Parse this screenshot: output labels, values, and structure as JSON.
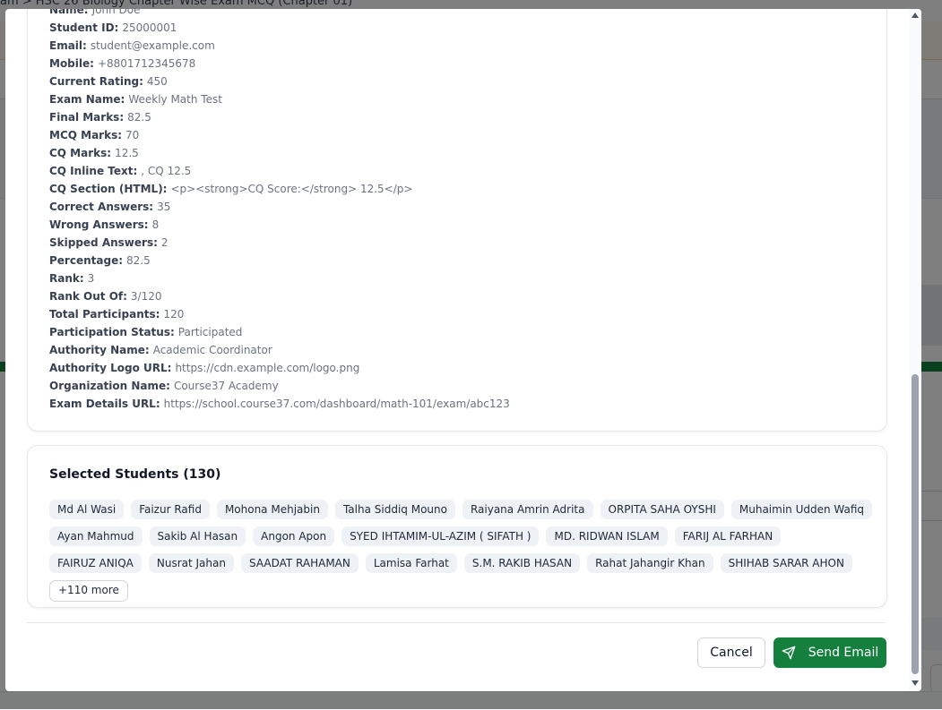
{
  "background": {
    "breadcrumb": "am  >  HSC 26 Biology Chapter Wise Exam MCQ (Chapter 01)"
  },
  "variables": [
    {
      "label": "Name:",
      "value": "John Doe"
    },
    {
      "label": "Student ID:",
      "value": "25000001"
    },
    {
      "label": "Email:",
      "value": "student@example.com"
    },
    {
      "label": "Mobile:",
      "value": "+8801712345678"
    },
    {
      "label": "Current Rating:",
      "value": "450"
    },
    {
      "label": "Exam Name:",
      "value": "Weekly Math Test"
    },
    {
      "label": "Final Marks:",
      "value": "82.5"
    },
    {
      "label": "MCQ Marks:",
      "value": "70"
    },
    {
      "label": "CQ Marks:",
      "value": "12.5"
    },
    {
      "label": "CQ Inline Text:",
      "value": ", CQ 12.5"
    },
    {
      "label": "CQ Section (HTML):",
      "value": "<p><strong>CQ Score:</strong> 12.5</p>"
    },
    {
      "label": "Correct Answers:",
      "value": "35"
    },
    {
      "label": "Wrong Answers:",
      "value": "8"
    },
    {
      "label": "Skipped Answers:",
      "value": "2"
    },
    {
      "label": "Percentage:",
      "value": "82.5"
    },
    {
      "label": "Rank:",
      "value": "3"
    },
    {
      "label": "Rank Out Of:",
      "value": "3/120"
    },
    {
      "label": "Total Participants:",
      "value": "120"
    },
    {
      "label": "Participation Status:",
      "value": "Participated"
    },
    {
      "label": "Authority Name:",
      "value": "Academic Coordinator"
    },
    {
      "label": "Authority Logo URL:",
      "value": "https://cdn.example.com/logo.png"
    },
    {
      "label": "Organization Name:",
      "value": "Course37 Academy"
    },
    {
      "label": "Exam Details URL:",
      "value": "https://school.course37.com/dashboard/math-101/exam/abc123"
    }
  ],
  "students": {
    "title": "Selected Students (130)",
    "chips": [
      "Md Al Wasi",
      "Faizur Rafid",
      "Mohona Mehjabin",
      "Talha Siddiq Mouno",
      "Raiyana Amrin Adrita",
      "ORPITA SAHA OYSHI",
      "Muhaimin Udden Wafiq",
      "Ayan Mahmud",
      "Sakib Al Hasan",
      "Angon Apon",
      "SYED IHTAMIM-UL-AZIM ( SIFATH )",
      "MD. RIDWAN ISLAM",
      "FARIJ AL FARHAN",
      "FAIRUZ ANIQA",
      "Nusrat Jahan",
      "SAADAT RAHAMAN",
      "Lamisa Farhat",
      "S.M. RAKIB HASAN",
      "Rahat Jahangir Khan",
      "SHIHAB SARAR AHON"
    ],
    "more_label": "+110 more"
  },
  "footer": {
    "cancel_label": "Cancel",
    "send_label": "Send Email"
  },
  "colors": {
    "primary": "#15803d",
    "chip_bg": "#eef1f6"
  }
}
